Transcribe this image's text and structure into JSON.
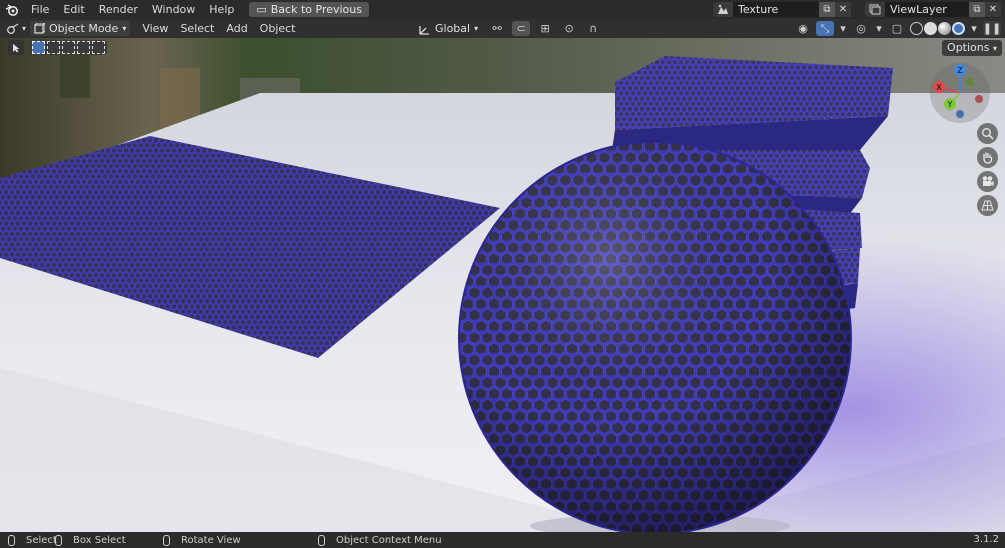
{
  "topbar": {
    "menus": [
      "File",
      "Edit",
      "Render",
      "Window",
      "Help"
    ],
    "back_button": "Back to Previous",
    "scene_name": "Texture",
    "view_layer": "ViewLayer"
  },
  "viewport_header": {
    "mode": "Object Mode",
    "menus": [
      "View",
      "Select",
      "Add",
      "Object"
    ],
    "transform_orientation": "Global",
    "options_label": "Options"
  },
  "gizmo": {
    "x": "X",
    "y": "Y",
    "z": "Z"
  },
  "statusbar": {
    "select": "Select",
    "box_select": "Box Select",
    "rotate_view": "Rotate View",
    "context_menu": "Object Context Menu",
    "version": "3.1.2"
  },
  "colors": {
    "accent": "#4772b3",
    "material": "#3d37b0",
    "floor": "#e4e5ea"
  }
}
